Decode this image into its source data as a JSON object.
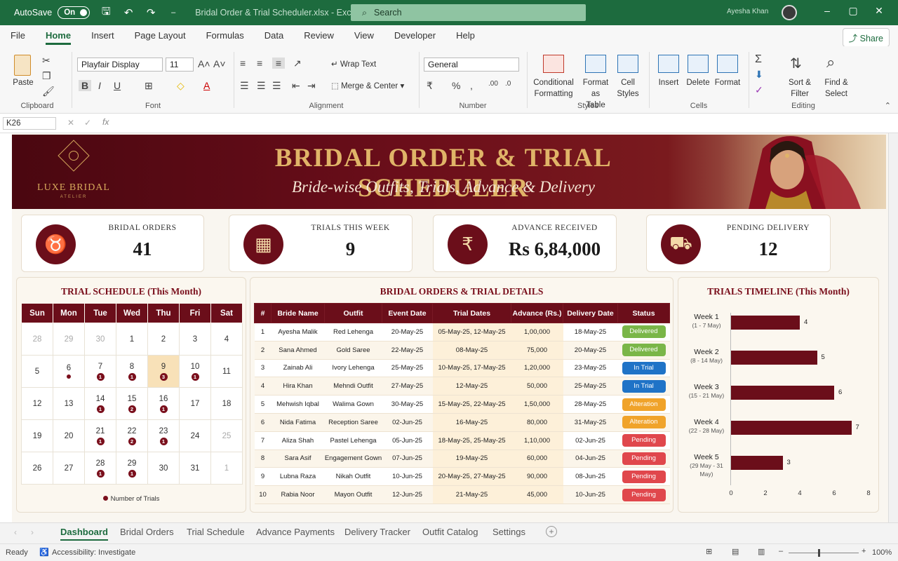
{
  "titlebar": {
    "autosave": "AutoSave",
    "toggle": "On",
    "filename": "Bridal Order & Trial Scheduler.xlsx - Excel",
    "search": "Search",
    "user": "Ayesha Khan"
  },
  "menu": [
    "File",
    "Home",
    "Insert",
    "Page Layout",
    "Formulas",
    "Data",
    "Review",
    "View",
    "Developer",
    "Help"
  ],
  "share": "Share",
  "ribbon": {
    "paste": "Paste",
    "clipboard": "Clipboard",
    "font_name": "Playfair Display",
    "font_size": "11",
    "font": "Font",
    "wrap": "Wrap Text",
    "merge": "Merge & Center",
    "alignment": "Alignment",
    "number_format": "General",
    "number": "Number",
    "cond1": "Conditional",
    "cond2": "Formatting",
    "fmt1": "Format as",
    "fmt2": "Table",
    "cell1": "Cell",
    "cell2": "Styles",
    "styles": "Styles",
    "insert": "Insert",
    "delete": "Delete",
    "format": "Format",
    "cells": "Cells",
    "sort1": "Sort &",
    "sort2": "Filter",
    "find1": "Find &",
    "find2": "Select",
    "editing": "Editing"
  },
  "namebox": "K26",
  "banner": {
    "logo_title": "LUXE BRIDAL",
    "logo_sub": "ATELIER",
    "title": "BRIDAL ORDER & TRIAL SCHEDULER",
    "subtitle": "Bride-wise Outfits, Trials, Advance & Delivery"
  },
  "kpis": [
    {
      "label": "BRIDAL ORDERS",
      "value": "41",
      "icon": "dress-icon"
    },
    {
      "label": "TRIALS THIS WEEK",
      "value": "9",
      "icon": "calendar-icon"
    },
    {
      "label": "ADVANCE RECEIVED",
      "value": "Rs 6,84,000",
      "icon": "rupee-icon"
    },
    {
      "label": "PENDING DELIVERY",
      "value": "12",
      "icon": "truck-icon"
    }
  ],
  "calendar": {
    "title": "TRIAL SCHEDULE (This Month)",
    "days": [
      "Sun",
      "Mon",
      "Tue",
      "Wed",
      "Thu",
      "Fri",
      "Sat"
    ],
    "weeks": [
      [
        {
          "d": "28",
          "dim": true
        },
        {
          "d": "29",
          "dim": true
        },
        {
          "d": "30",
          "dim": true
        },
        {
          "d": "1"
        },
        {
          "d": "2"
        },
        {
          "d": "3"
        },
        {
          "d": "4"
        }
      ],
      [
        {
          "d": "5"
        },
        {
          "d": "6",
          "dot": ""
        },
        {
          "d": "7",
          "dot": "1"
        },
        {
          "d": "8",
          "dot": "1"
        },
        {
          "d": "9",
          "dot": "3",
          "today": true
        },
        {
          "d": "10",
          "dot": "1"
        },
        {
          "d": "11"
        }
      ],
      [
        {
          "d": "12"
        },
        {
          "d": "13"
        },
        {
          "d": "14",
          "dot": "1"
        },
        {
          "d": "15",
          "dot": "2"
        },
        {
          "d": "16",
          "dot": "1"
        },
        {
          "d": "17"
        },
        {
          "d": "18"
        }
      ],
      [
        {
          "d": "19"
        },
        {
          "d": "20"
        },
        {
          "d": "21",
          "dot": "1"
        },
        {
          "d": "22",
          "dot": "2"
        },
        {
          "d": "23",
          "dot": "1"
        },
        {
          "d": "24"
        },
        {
          "d": "25",
          "dim": true
        }
      ],
      [
        {
          "d": "26"
        },
        {
          "d": "27"
        },
        {
          "d": "28",
          "dot": "1"
        },
        {
          "d": "29",
          "dot": "1"
        },
        {
          "d": "30"
        },
        {
          "d": "31"
        },
        {
          "d": "1",
          "dim": true
        }
      ]
    ],
    "legend": "Number of Trials"
  },
  "orders": {
    "title": "BRIDAL ORDERS & TRIAL DETAILS",
    "headers": [
      "#",
      "Bride Name",
      "Outfit",
      "Event Date",
      "Trial Dates",
      "Advance (Rs.)",
      "Delivery Date",
      "Status"
    ],
    "rows": [
      [
        "1",
        "Ayesha Malik",
        "Red Lehenga",
        "20-May-25",
        "05-May-25, 12-May-25",
        "1,00,000",
        "18-May-25",
        "Delivered"
      ],
      [
        "2",
        "Sana Ahmed",
        "Gold Saree",
        "22-May-25",
        "08-May-25",
        "75,000",
        "20-May-25",
        "Delivered"
      ],
      [
        "3",
        "Zainab Ali",
        "Ivory Lehenga",
        "25-May-25",
        "10-May-25, 17-May-25",
        "1,20,000",
        "23-May-25",
        "In Trial"
      ],
      [
        "4",
        "Hira Khan",
        "Mehndi Outfit",
        "27-May-25",
        "12-May-25",
        "50,000",
        "25-May-25",
        "In Trial"
      ],
      [
        "5",
        "Mehwish Iqbal",
        "Walima Gown",
        "30-May-25",
        "15-May-25, 22-May-25",
        "1,50,000",
        "28-May-25",
        "Alteration"
      ],
      [
        "6",
        "Nida Fatima",
        "Reception Saree",
        "02-Jun-25",
        "16-May-25",
        "80,000",
        "31-May-25",
        "Alteration"
      ],
      [
        "7",
        "Aliza Shah",
        "Pastel Lehenga",
        "05-Jun-25",
        "18-May-25, 25-May-25",
        "1,10,000",
        "02-Jun-25",
        "Pending"
      ],
      [
        "8",
        "Sara Asif",
        "Engagement Gown",
        "07-Jun-25",
        "19-May-25",
        "60,000",
        "04-Jun-25",
        "Pending"
      ],
      [
        "9",
        "Lubna Raza",
        "Nikah Outfit",
        "10-Jun-25",
        "20-May-25, 27-May-25",
        "90,000",
        "08-Jun-25",
        "Pending"
      ],
      [
        "10",
        "Rabia Noor",
        "Mayon Outfit",
        "12-Jun-25",
        "21-May-25",
        "45,000",
        "10-Jun-25",
        "Pending"
      ]
    ]
  },
  "chart_data": {
    "type": "bar",
    "orientation": "horizontal",
    "title": "TRIALS TIMELINE (This Month)",
    "categories": [
      "Week 1",
      "Week 2",
      "Week 3",
      "Week 4",
      "Week 5"
    ],
    "subcategories": [
      "(1 - 7 May)",
      "(8 - 14 May)",
      "(15 - 21 May)",
      "(22 - 28 May)",
      "(29 May - 31 May)"
    ],
    "values": [
      4,
      5,
      6,
      7,
      3
    ],
    "xlim": [
      0,
      8
    ],
    "xticks": [
      "0",
      "2",
      "4",
      "6",
      "8"
    ],
    "bar_color": "#6b0e1a"
  },
  "sheet_tabs": [
    "Dashboard",
    "Bridal Orders",
    "Trial Schedule",
    "Advance Payments",
    "Delivery Tracker",
    "Outfit Catalog",
    "Settings"
  ],
  "status": {
    "ready": "Ready",
    "accessibility": "Accessibility: Investigate",
    "zoom": "100%"
  },
  "colors": {
    "accent": "#1d6b3e",
    "maroon": "#6b0e1a",
    "gold": "#d6a95c"
  }
}
